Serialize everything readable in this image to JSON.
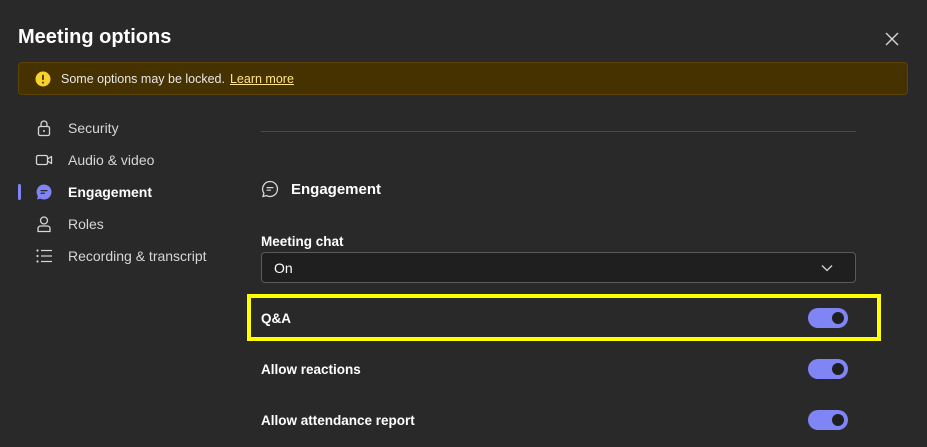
{
  "dialog": {
    "title": "Meeting options",
    "close_icon": "close-icon"
  },
  "banner": {
    "icon": "warning-icon",
    "message": "Some options may be locked.",
    "link": "Learn more"
  },
  "nav": {
    "items": [
      {
        "label": "Security",
        "icon": "lock-icon",
        "active": false
      },
      {
        "label": "Audio & video",
        "icon": "video-camera-icon",
        "active": false
      },
      {
        "label": "Engagement",
        "icon": "chat-bubble-icon",
        "active": true
      },
      {
        "label": "Roles",
        "icon": "person-icon",
        "active": false
      },
      {
        "label": "Recording & transcript",
        "icon": "list-icon",
        "active": false
      }
    ]
  },
  "engagement": {
    "heading": "Engagement",
    "meeting_chat": {
      "label": "Meeting chat",
      "value": "On"
    },
    "toggles": [
      {
        "label": "Q&A",
        "on": true,
        "highlighted": true
      },
      {
        "label": "Allow reactions",
        "on": true
      },
      {
        "label": "Allow attendance report",
        "on": true
      }
    ]
  },
  "colors": {
    "background": "#292929",
    "accent": "#7f85f5",
    "banner_bg": "#463100",
    "highlight": "#ffff00"
  }
}
